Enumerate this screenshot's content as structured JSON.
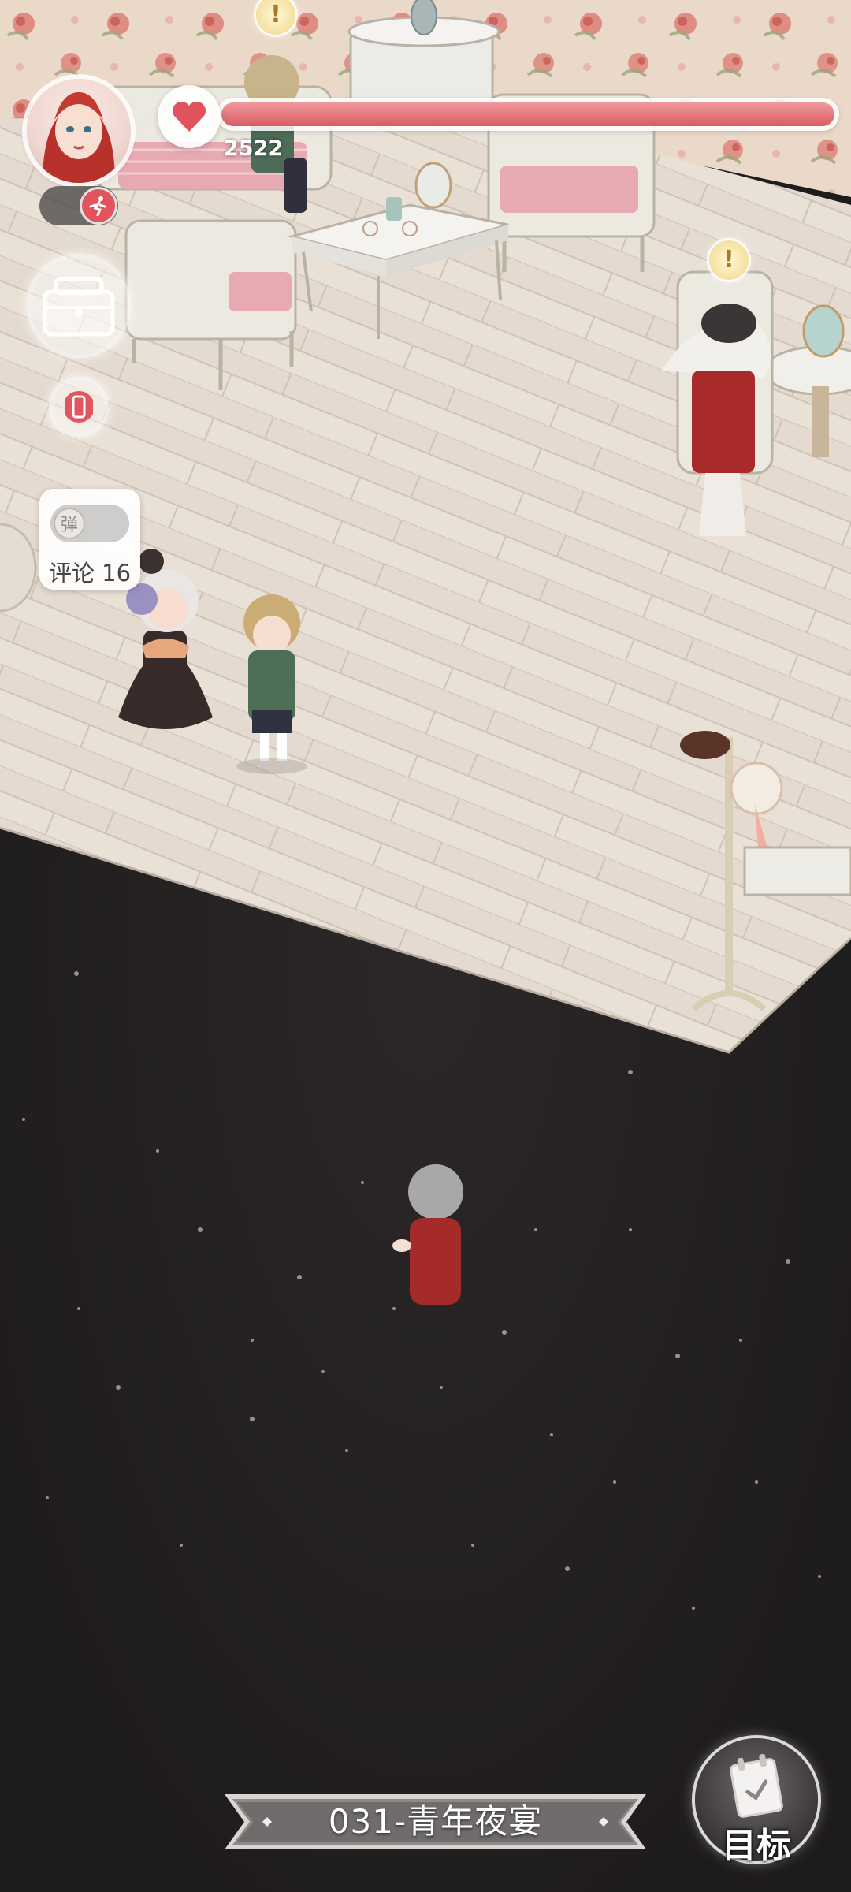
{
  "hud": {
    "hp_value": "2522",
    "hp_fill": 1.0,
    "avatar_icon": "red-haired-heroine-portrait",
    "heart_icon": "heart-icon",
    "run_icon": "running-figure-icon",
    "wardrobe_icon": "suitcase-icon",
    "phone_icon": "phone-icon"
  },
  "comments": {
    "danmaku_label": "弹",
    "count_label": "评论 16"
  },
  "chapter": {
    "title": "031-青年夜宴"
  },
  "goal": {
    "label": "目标",
    "icon": "calendar-check-icon"
  },
  "alerts": {
    "symbol": "!"
  },
  "colors": {
    "hp_red": "#d85c63",
    "floor": "#e6ddd2",
    "wall": "#e8d6c6",
    "void": "#232021"
  }
}
